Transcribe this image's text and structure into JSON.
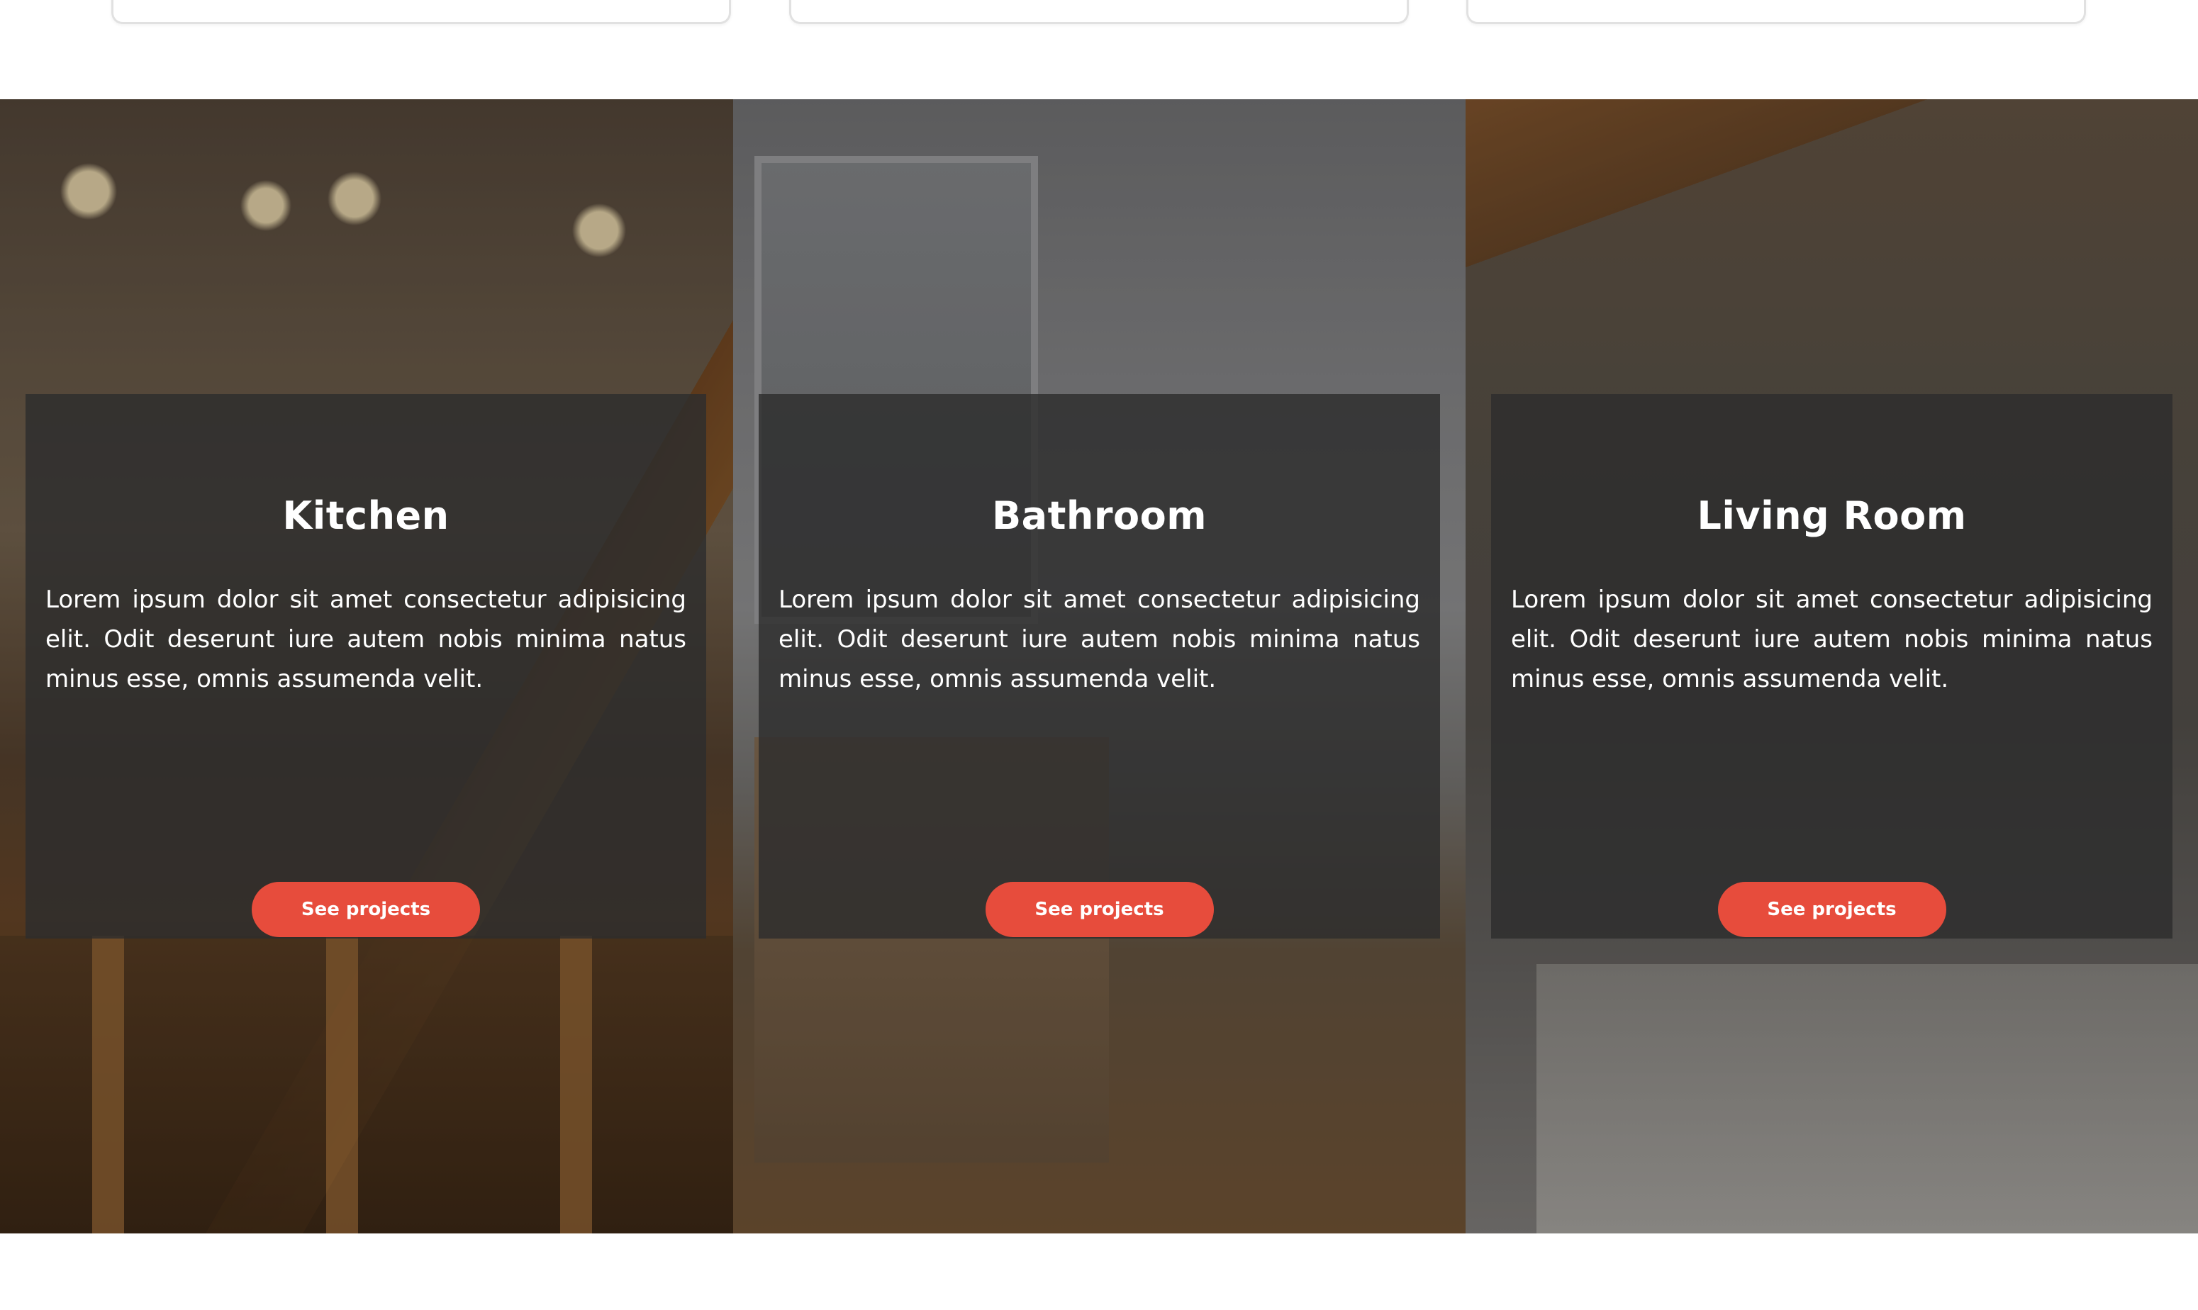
{
  "services": [
    {
      "title": "Kitchen",
      "description": "Lorem ipsum dolor sit amet consectetur adipisicing elit. Odit deserunt iure autem nobis minima natus minus esse, omnis assumenda velit.",
      "button_label": "See projects"
    },
    {
      "title": "Bathroom",
      "description": "Lorem ipsum dolor sit amet consectetur adipisicing elit. Odit deserunt iure autem nobis minima natus minus esse, omnis assumenda velit.",
      "button_label": "See projects"
    },
    {
      "title": "Living Room",
      "description": "Lorem ipsum dolor sit amet consectetur adipisicing elit. Odit deserunt iure autem nobis minima natus minus esse, omnis assumenda velit.",
      "button_label": "See projects"
    }
  ],
  "colors": {
    "accent": "#e74c3c",
    "overlay": "#2d2d2d"
  }
}
